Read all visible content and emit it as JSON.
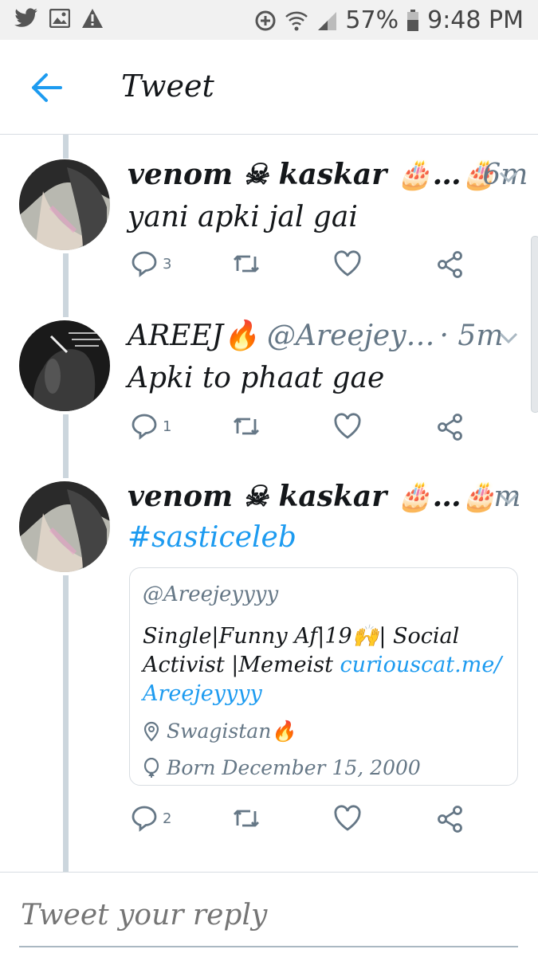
{
  "status_bar": {
    "icons_left": [
      "twitter-bird-icon",
      "image-icon",
      "warning-icon"
    ],
    "icons_right": [
      "data-saver-icon",
      "wifi-icon",
      "signal-icon",
      "battery-icon"
    ],
    "battery": "57%",
    "time": "9:48 PM"
  },
  "header": {
    "title": "Tweet"
  },
  "tweets": [
    {
      "name": "venom ☠ kaskar 🎂…🎂",
      "handle": "",
      "time": "6m",
      "text": "yani apki jal gai",
      "reply_count": "3"
    },
    {
      "name": "AREEJ🔥",
      "handle": "@Areejey…",
      "time": "· 5m",
      "text": "Apki to phaat gae",
      "reply_count": "1"
    },
    {
      "name": "venom ☠ kaskar 🎂…🎂",
      "handle": "",
      "time": "m",
      "text": "#sasticeleb",
      "reply_count": "2"
    }
  ],
  "profile_card": {
    "handle": "@Areejeyyyy",
    "bio": "Single|Funny Af|19🙌| Social Activist |Memeist ",
    "bio_link_1": "curiouscat.me/",
    "bio_link_2": "Areejeyyyy",
    "location": "Swagistan🔥",
    "birthday": "Born December 15, 2000"
  },
  "reply": {
    "placeholder": "Tweet your reply"
  },
  "colors": {
    "accent": "#1d9bf0",
    "secondary_text": "#657786",
    "thread_line": "#ccd6dd"
  }
}
